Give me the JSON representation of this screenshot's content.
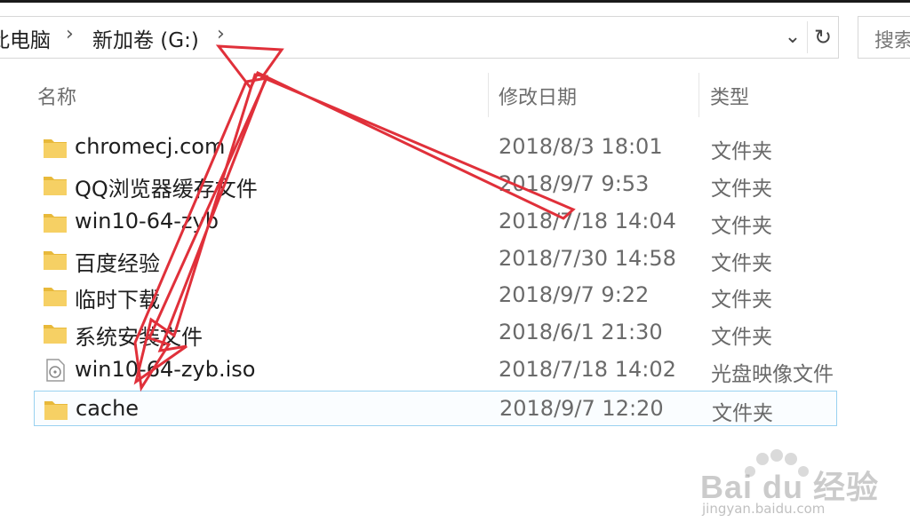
{
  "address_bar": {
    "crumbs": [
      "此电脑",
      "新加卷 (G:)"
    ]
  },
  "search": {
    "placeholder_label": "搜索"
  },
  "columns": {
    "name": "名称",
    "modified": "修改日期",
    "type": "类型"
  },
  "files": [
    {
      "name": "chromecj.com",
      "modified": "2018/8/3 18:01",
      "type": "文件夹",
      "icon": "folder-icon"
    },
    {
      "name": "QQ浏览器缓存文件",
      "modified": "2018/9/7 9:53",
      "type": "文件夹",
      "icon": "folder-icon"
    },
    {
      "name": "win10-64-zyb",
      "modified": "2018/7/18 14:04",
      "type": "文件夹",
      "icon": "folder-icon"
    },
    {
      "name": "百度经验",
      "modified": "2018/7/30 14:58",
      "type": "文件夹",
      "icon": "folder-icon"
    },
    {
      "name": "临时下载",
      "modified": "2018/9/7 9:22",
      "type": "文件夹",
      "icon": "folder-icon"
    },
    {
      "name": "系统安装文件",
      "modified": "2018/6/1 21:30",
      "type": "文件夹",
      "icon": "folder-icon"
    },
    {
      "name": "win10-64-zyb.iso",
      "modified": "2018/7/18 14:02",
      "type": "光盘映像文件",
      "icon": "disc-image-icon"
    },
    {
      "name": "cache",
      "modified": "2018/9/7 12:20",
      "type": "文件夹",
      "icon": "folder-icon",
      "selected": true
    }
  ],
  "watermark": {
    "brand": "Bai du 经验",
    "url": "jingyan.baidu.com"
  },
  "colors": {
    "annotation_arrow": "#e0303a",
    "selection_border": "#99d1f0",
    "folder": "#f2c94c"
  }
}
